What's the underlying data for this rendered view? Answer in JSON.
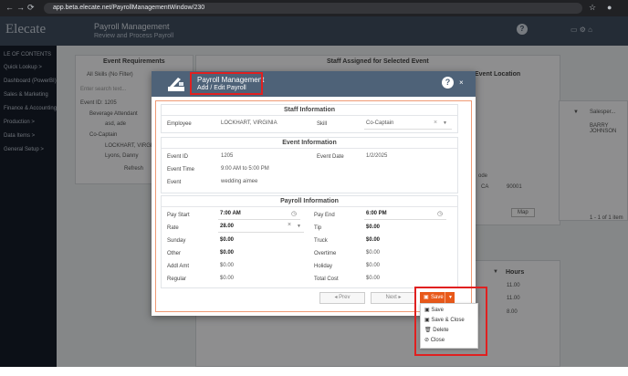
{
  "browser": {
    "url": "app.beta.elecate.net/PayrollManagementWindow/230"
  },
  "app": {
    "brand": "Elecate",
    "header_title": "Payroll Management",
    "header_subtitle": "Review and Process Payroll"
  },
  "sidebar": {
    "items": [
      {
        "label": "LE OF CONTENTS"
      },
      {
        "label": "Quick Lookup  >"
      },
      {
        "label": "Dashboard (PowerBI)"
      },
      {
        "label": "Sales & Marketing"
      },
      {
        "label": "Finance & Accounting"
      },
      {
        "label": "Production  >"
      },
      {
        "label": "Data Items  >"
      },
      {
        "label": "General Setup  >"
      }
    ]
  },
  "background": {
    "event_requirements": "Event Requirements",
    "all_skills": "All Skills (No Filter)",
    "search_placeholder": "Enter search text...",
    "event_id_node": "Event ID: 1205",
    "beverage": "Beverage Attendant",
    "asd": "asd, ade",
    "co_captain": "Co-Captain",
    "lockhart": "LOCKHART, VIRGINIA",
    "lyons": "Lyons, Danny",
    "refresh": "Refresh",
    "staff_assigned": "Staff Assigned for Selected Event",
    "event_location": "Event Location",
    "salesperson": "Salesper...",
    "barry": "BARRY JOHNSON",
    "ca": "CA",
    "zip": "90001",
    "map": "Map",
    "pager": "1 - 1 of 1 item",
    "hours_header": "Hours",
    "hours": [
      "11.00",
      "11.00",
      "8.00"
    ],
    "ode": "ode"
  },
  "modal": {
    "title": "Payroll Management",
    "subtitle": "Add / Edit Payroll",
    "help": "?",
    "close": "×",
    "staff": {
      "title": "Staff Information",
      "employee_label": "Employee",
      "employee_value": "LOCKHART, VIRGINIA",
      "skill_label": "Skill",
      "skill_value": "Co-Captain"
    },
    "event": {
      "title": "Event Information",
      "id_label": "Event ID",
      "id_value": "1205",
      "date_label": "Event Date",
      "date_value": "1/2/2025",
      "time_label": "Event Time",
      "time_value": "9:00 AM to 5:00 PM",
      "event_label": "Event",
      "event_value": "wedding aimee"
    },
    "payroll": {
      "title": "Payroll Information",
      "pay_start_label": "Pay Start",
      "pay_start_value": "7:00 AM",
      "pay_end_label": "Pay End",
      "pay_end_value": "6:00 PM",
      "rate_label": "Rate",
      "rate_value": "28.00",
      "tip_label": "Tip",
      "tip_value": "$0.00",
      "sunday_label": "Sunday",
      "sunday_value": "$0.00",
      "truck_label": "Truck",
      "truck_value": "$0.00",
      "other_label": "Other",
      "other_value": "$0.00",
      "overtime_label": "Overtime",
      "overtime_value": "$0.00",
      "addl_label": "Addl Amt",
      "addl_value": "$0.00",
      "holiday_label": "Holiday",
      "holiday_value": "$0.00",
      "regular_label": "Regular",
      "regular_value": "$0.00",
      "total_label": "Total Cost",
      "total_value": "$0.00"
    },
    "footer": {
      "prev": "◂ Prev",
      "next": "Next ▸",
      "save": "Save",
      "menu": [
        "Save",
        "Save & Close",
        "Delete",
        "Close"
      ]
    }
  },
  "colors": {
    "accent": "#e8591a",
    "header": "#4e6278",
    "highlight": "#e02020"
  }
}
